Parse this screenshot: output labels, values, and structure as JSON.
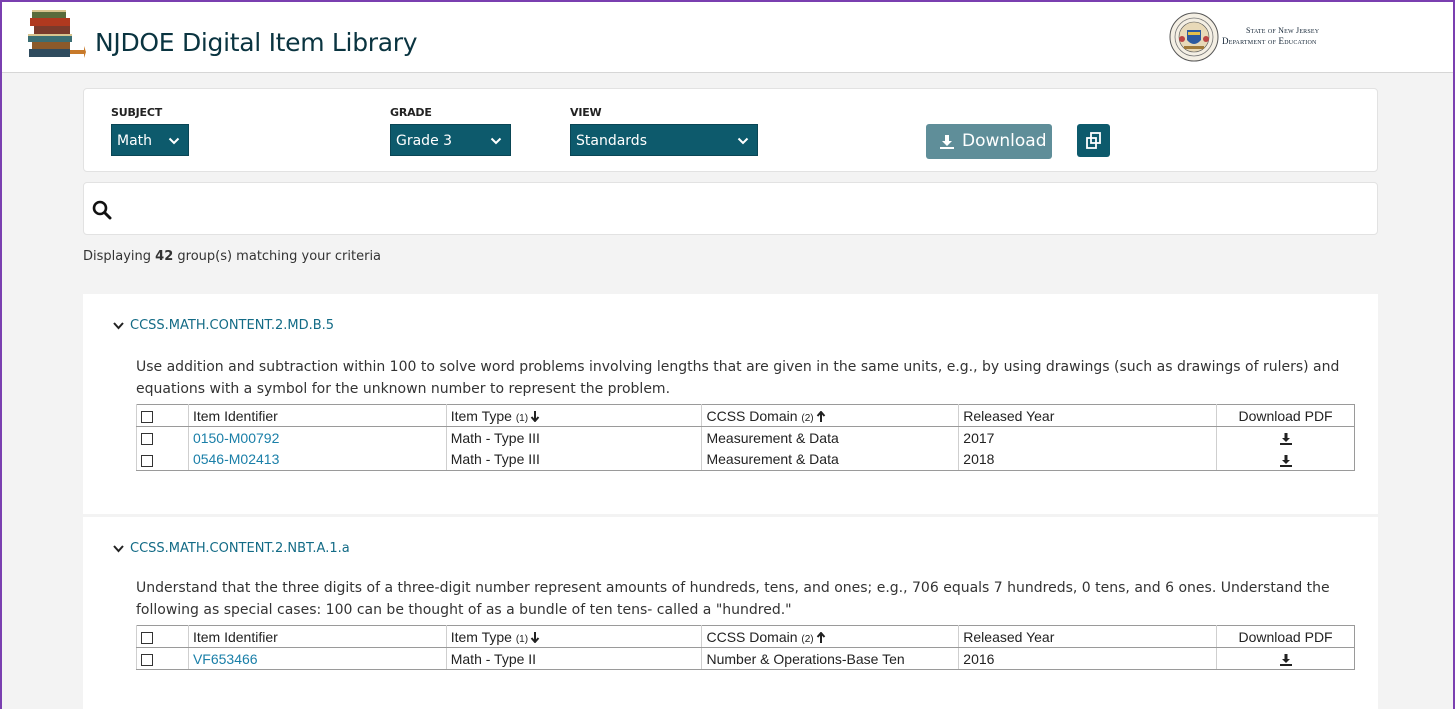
{
  "header": {
    "app_title": "NJDOE Digital Item Library",
    "state_line1": "State of New Jersey",
    "state_line2": "Department of Education"
  },
  "filters": {
    "subject_label": "SUBJECT",
    "subject_value": "Math",
    "grade_label": "GRADE",
    "grade_value": "Grade 3",
    "view_label": "VIEW",
    "view_value": "Standards",
    "download_label": "Download"
  },
  "search": {
    "placeholder": ""
  },
  "results": {
    "prefix": "Displaying ",
    "count": "42",
    "suffix": " group(s) matching your criteria"
  },
  "table_headers": {
    "item_identifier": "Item Identifier",
    "item_type": "Item Type ",
    "item_type_sort": "(1)",
    "ccss_domain": "CCSS Domain ",
    "ccss_domain_sort": "(2)",
    "released_year": "Released Year",
    "download_pdf": "Download PDF"
  },
  "groups": [
    {
      "code": "CCSS.MATH.CONTENT.2.MD.B.5",
      "description": "Use addition and subtraction within 100 to solve word problems involving lengths that are given in the same units, e.g., by using drawings (such as drawings of rulers) and equations with a symbol for the unknown number to represent the problem.",
      "rows": [
        {
          "id": "0150-M00792",
          "type": "Math - Type III",
          "domain": "Measurement & Data",
          "year": "2017"
        },
        {
          "id": "0546-M02413",
          "type": "Math - Type III",
          "domain": "Measurement & Data",
          "year": "2018"
        }
      ]
    },
    {
      "code": "CCSS.MATH.CONTENT.2.NBT.A.1.a",
      "description": "Understand that the three digits of a three-digit number represent amounts of hundreds, tens, and ones; e.g., 706 equals 7 hundreds, 0 tens, and 6 ones. Understand the following as special cases: 100 can be thought of as a bundle of ten tens- called a \"hundred.\"",
      "rows": [
        {
          "id": "VF653466",
          "type": "Math - Type II",
          "domain": "Number & Operations-Base Ten",
          "year": "2016"
        }
      ]
    }
  ],
  "colors": {
    "accent": "#0d5a6c",
    "link": "#1a7fa8",
    "download_button": "#5f8e99",
    "frame": "#7a3fb0"
  }
}
